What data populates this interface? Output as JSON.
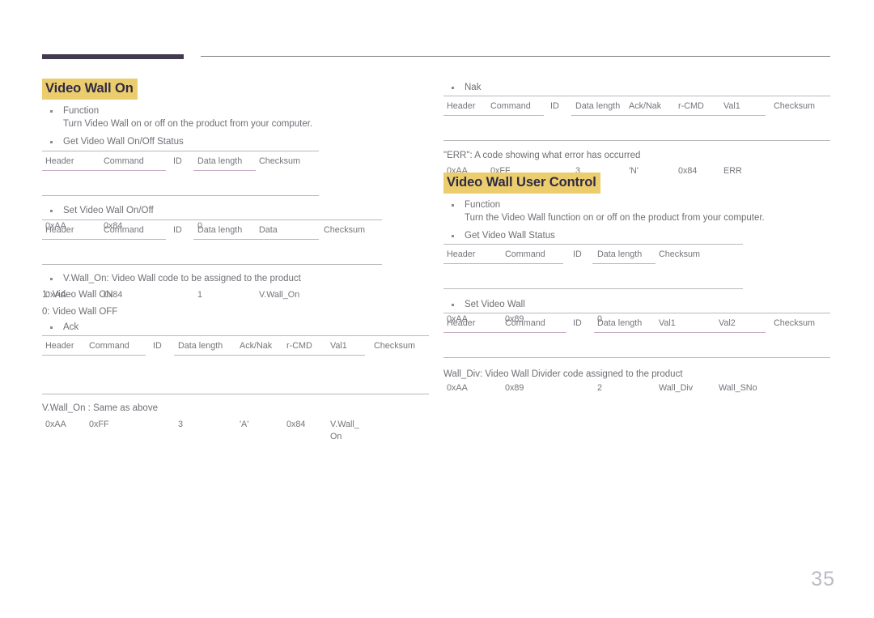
{
  "page": {
    "number": "35"
  },
  "left_column": {
    "section_title": "Video Wall On",
    "function_label": "Function",
    "function_desc": "Turn Video Wall on or off on the product from your computer.",
    "get_status_label": "Get Video Wall On/Off Status",
    "get_status_table": {
      "headers": [
        "Header",
        "Command",
        "ID",
        "Data length",
        "Checksum"
      ],
      "values": [
        "0xAA",
        "0x84",
        "",
        "0",
        ""
      ]
    },
    "set_label": "Set Video Wall On/Off",
    "set_table": {
      "headers": [
        "Header",
        "Command",
        "ID",
        "Data length",
        "Data",
        "Checksum"
      ],
      "values": [
        "0xAA",
        "0x84",
        "",
        "1",
        "V.Wall_On",
        ""
      ]
    },
    "code_note": "V.Wall_On: Video Wall code to be assigned to the product",
    "code_on": "1: Video Wall ON",
    "code_off": "0: Video Wall OFF",
    "ack_label": "Ack",
    "ack_table": {
      "headers": [
        "Header",
        "Command",
        "ID",
        "Data length",
        "Ack/Nak",
        "r-CMD",
        "Val1",
        "Checksum"
      ],
      "values": [
        "0xAA",
        "0xFF",
        "",
        "3",
        "'A'",
        "0x84",
        "V.Wall_\nOn",
        ""
      ]
    },
    "ack_note": "V.Wall_On : Same as above"
  },
  "right_column": {
    "nak_label": "Nak",
    "nak_table": {
      "headers": [
        "Header",
        "Command",
        "ID",
        "Data length",
        "Ack/Nak",
        "r-CMD",
        "Val1",
        "Checksum"
      ],
      "values": [
        "0xAA",
        "0xFF",
        "",
        "3",
        "'N'",
        "0x84",
        "ERR",
        ""
      ]
    },
    "err_note": "\"ERR\": A code showing what error has occurred",
    "section_title": "Video Wall User Control",
    "function_label": "Function",
    "function_desc": "Turn the Video Wall function on or off on the product from your computer.",
    "get_status_label": "Get Video Wall Status",
    "get_status_table": {
      "headers": [
        "Header",
        "Command",
        "ID",
        "Data length",
        "Checksum"
      ],
      "values": [
        "0xAA",
        "0x89",
        "",
        "0",
        ""
      ]
    },
    "set_label": "Set Video Wall",
    "set_table": {
      "headers": [
        "Header",
        "Command",
        "ID",
        "Data length",
        "Val1",
        "Val2",
        "Checksum"
      ],
      "values": [
        "0xAA",
        "0x89",
        "",
        "2",
        "Wall_Div",
        "Wall_SNo",
        ""
      ]
    },
    "wall_div_note": "Wall_Div: Video Wall Divider code assigned to the product"
  },
  "colors": {
    "heading_highlight": "#eccd6d",
    "heading_text": "#2f2a44",
    "header_bar": "#433a51",
    "body_text": "#6f6f76",
    "table_rule": "#b9b9be",
    "table_mid_rule": "#c9aec6"
  }
}
